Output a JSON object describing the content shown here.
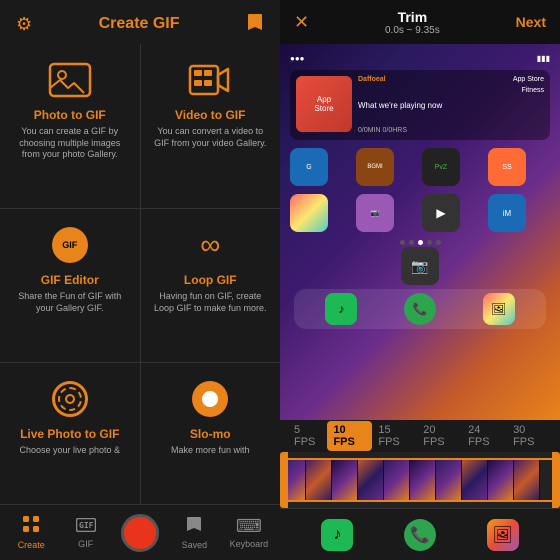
{
  "left": {
    "header": {
      "title": "Create GIF",
      "gear_label": "⚙",
      "save_label": "🔖"
    },
    "grid": [
      {
        "id": "photo-to-gif",
        "title": "Photo to GIF",
        "desc": "You can create a GIF by choosing multiple images from your photo Gallery.",
        "icon_type": "photo"
      },
      {
        "id": "video-to-gif",
        "title": "Video to GIF",
        "desc": "You can convert a video to GIF from your video Gallery.",
        "icon_type": "video"
      },
      {
        "id": "gif-editor",
        "title": "GIF Editor",
        "desc": "Share the Fun of GIF with your Gallery GIF.",
        "icon_type": "gif"
      },
      {
        "id": "loop-gif",
        "title": "Loop GIF",
        "desc": "Having fun on GIF, create Loop GIF to make fun more.",
        "icon_type": "loop"
      },
      {
        "id": "live-photo-to-gif",
        "title": "Live Photo to GIF",
        "desc": "Choose your live photo &",
        "icon_type": "live"
      },
      {
        "id": "slo-mo",
        "title": "Slo-mo",
        "desc": "Make more fun with",
        "icon_type": "slomo"
      }
    ],
    "tab_bar": {
      "items": [
        {
          "id": "create",
          "label": "Create",
          "icon": "➕",
          "active": true
        },
        {
          "id": "gif",
          "label": "GIF",
          "icon": "🖼",
          "active": false
        },
        {
          "id": "record",
          "label": "",
          "icon": "",
          "active": false,
          "is_record": true
        },
        {
          "id": "saved",
          "label": "Saved",
          "icon": "⬇",
          "active": false
        },
        {
          "id": "keyboard",
          "label": "Keyboard",
          "icon": "⌨",
          "active": false
        }
      ]
    }
  },
  "right": {
    "header": {
      "close_label": "✕",
      "title": "Trim",
      "time_range": "0.0s ~ 9.35s",
      "next_label": "Next"
    },
    "fps_options": [
      {
        "value": "5 FPS",
        "active": false
      },
      {
        "value": "10 FPS",
        "active": true
      },
      {
        "value": "15 FPS",
        "active": false
      },
      {
        "value": "20 FPS",
        "active": false
      },
      {
        "value": "24 FPS",
        "active": false
      },
      {
        "value": "30 FPS",
        "active": false
      }
    ],
    "dock_apps": [
      {
        "id": "spotify",
        "color": "spotify"
      },
      {
        "id": "phone",
        "color": "phone"
      },
      {
        "id": "photos",
        "color": "photos"
      }
    ],
    "dot_indicators": [
      false,
      false,
      true,
      false,
      false
    ]
  }
}
